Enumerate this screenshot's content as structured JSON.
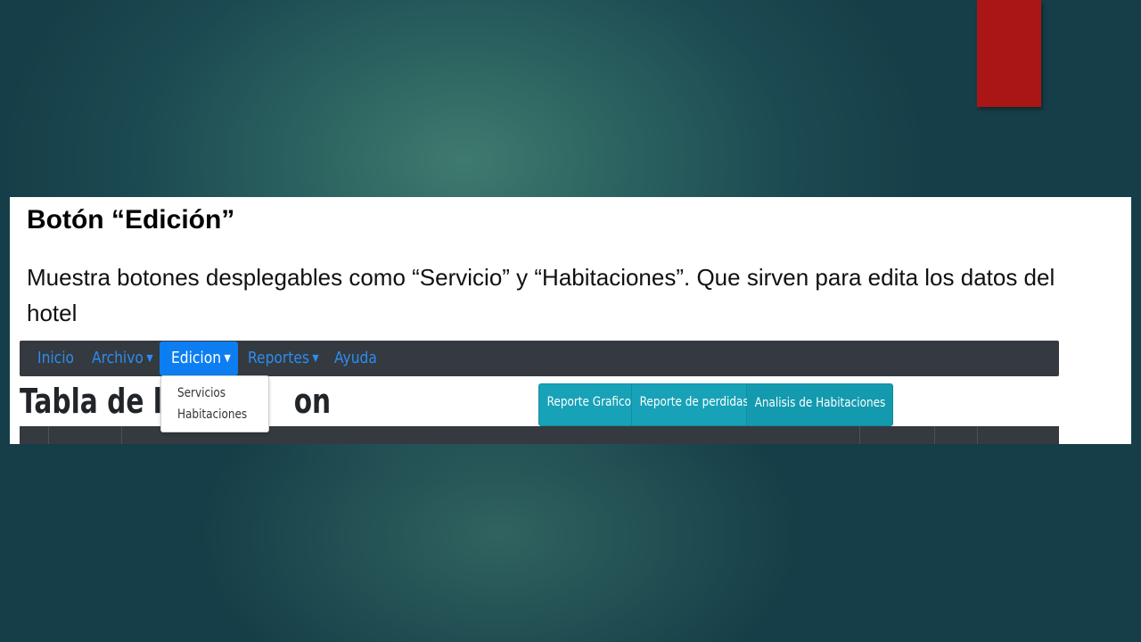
{
  "slide": {
    "title": "Botón “Edición”",
    "body": "Muestra botones desplegables como “Servicio” y “Habitaciones”. Que sirven para edita  los datos del hotel",
    "accent_color": "#aa1616"
  },
  "app": {
    "navbar": {
      "items": [
        {
          "label": "Inicio",
          "dropdown": false
        },
        {
          "label": "Archivo",
          "dropdown": true
        },
        {
          "label": "Edicion",
          "dropdown": true,
          "active": true
        },
        {
          "label": "Reportes",
          "dropdown": true
        },
        {
          "label": "Ayuda",
          "dropdown": false
        }
      ],
      "caret_icon": "caret-down-icon",
      "link_color": "#2d8cf0",
      "active_color": "#0d7ef2",
      "background": "#343a40"
    },
    "dropdown_menu": {
      "items": [
        "Servicios",
        "Habitaciones"
      ]
    },
    "page_heading": {
      "visible_start": "Tabla de la s",
      "visible_end": "on"
    },
    "report_buttons": [
      {
        "label": "Reporte Grafico",
        "dropdown": false
      },
      {
        "label": "Reporte de perdidas",
        "dropdown": false
      },
      {
        "label": "Analisis de Habitaciones",
        "dropdown": true
      }
    ],
    "button_color": "#17a2b8"
  }
}
